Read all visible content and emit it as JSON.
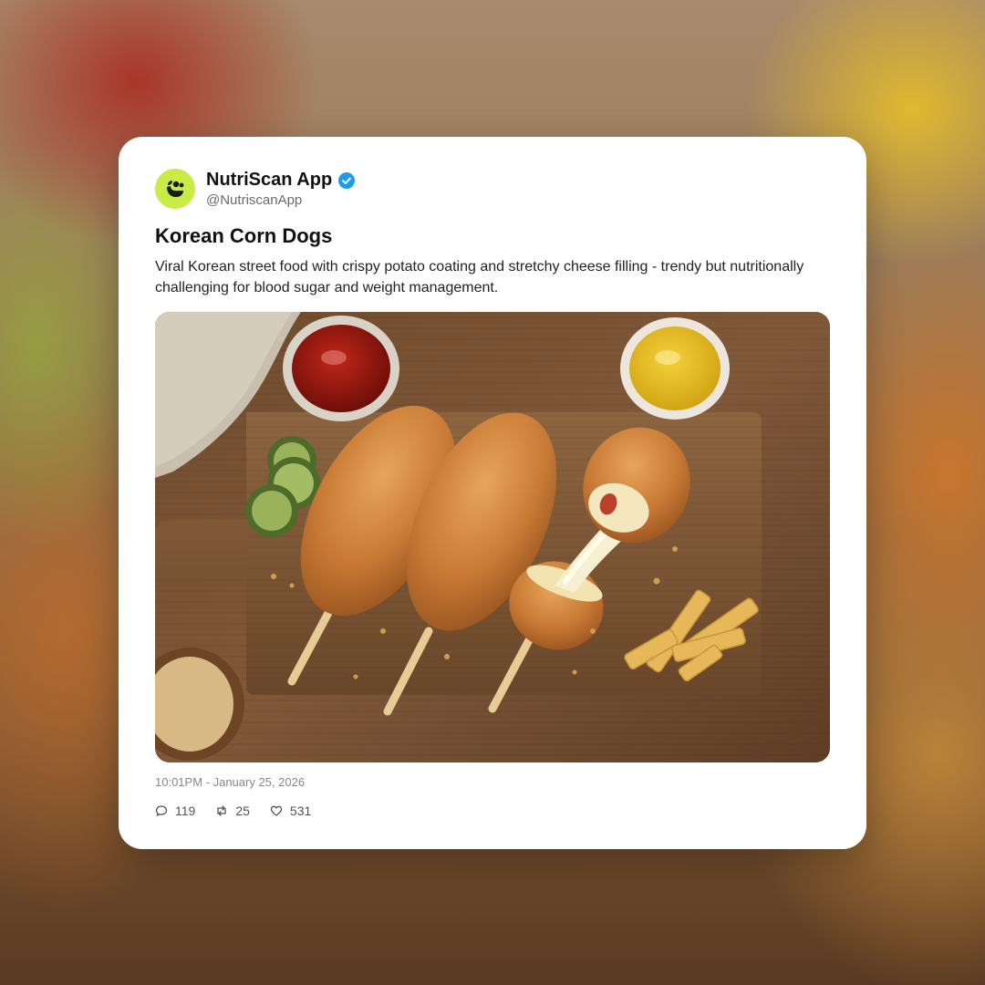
{
  "post": {
    "author_name": "NutriScan App",
    "author_handle": "@NutriscanApp",
    "verified": true,
    "title": "Korean Corn Dogs",
    "description": "Viral Korean street food with crispy potato coating and stretchy cheese filling - trendy but nutritionally challenging for blood sugar and weight management.",
    "timestamp": "10:01PM - January 25, 2026",
    "stats": {
      "replies": "119",
      "reposts": "25",
      "likes": "531"
    }
  },
  "icons": {
    "avatar": "nutriscan-logo-icon",
    "verified": "verified-badge-icon",
    "replies": "comment-icon",
    "reposts": "repost-icon",
    "likes": "heart-icon"
  },
  "colors": {
    "brand_avatar": "#c6ec45",
    "verified_badge": "#1d9bf0",
    "card_background": "#ffffff"
  }
}
